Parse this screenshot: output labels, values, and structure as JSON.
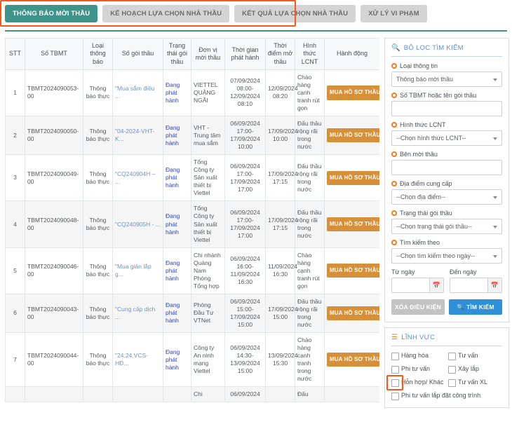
{
  "tabs": [
    {
      "label": "THÔNG BÁO MỜI THẦU",
      "active": true
    },
    {
      "label": "KẾ HOẠCH LỰA CHỌN NHÀ THẦU",
      "active": false
    },
    {
      "label": "KẾT QUẢ LỰA CHỌN NHÀ THẦU",
      "active": false
    },
    {
      "label": "XỬ LÝ VI PHẠM",
      "active": false
    }
  ],
  "table": {
    "headers": [
      "STT",
      "Số TBMT",
      "Loại thông báo",
      "Số gói thầu",
      "Trạng thái gói thầu",
      "Đơn vị mời thầu",
      "Thời gian phát hành",
      "Thời điểm mở thầu",
      "Hình thức LCNT",
      "Hành động"
    ],
    "action_label": "MUA HỒ SƠ THẦU",
    "rows": [
      {
        "stt": "1",
        "so_tbmt": "TBMT2024090053-00",
        "loai_thong_bao": "Thông báo thực",
        "so_goi_thau": "\"Mua sắm điều ...",
        "trang_thai": "Đang phát hành",
        "don_vi": "VIETTEL QUẢNG NGÃI",
        "thoi_gian_phat_hanh": "07/09/2024 08:00-12/09/2024 08:10",
        "thoi_diem_mo_thau": "12/09/2024 08:20",
        "hinh_thuc_lcnt": "Chào hàng cạnh tranh rút gọn"
      },
      {
        "stt": "2",
        "so_tbmt": "TBMT2024090050-00",
        "loai_thong_bao": "Thông báo thực",
        "so_goi_thau": "\"04-2024-VHT-K...",
        "trang_thai": "Đang phát hành",
        "don_vi": "VHT - Trung tâm mua sắm",
        "thoi_gian_phat_hanh": "06/09/2024 17:00-17/09/2024 10:00",
        "thoi_diem_mo_thau": "17/09/2024 10:00",
        "hinh_thuc_lcnt": "Đấu thầu rộng rãi trong nước"
      },
      {
        "stt": "3",
        "so_tbmt": "TBMT2024090049-00",
        "loai_thong_bao": "Thông báo thực",
        "so_goi_thau": "\"CQ240904H – ...",
        "trang_thai": "Đang phát hành",
        "don_vi": "Tổng Công ty Sản xuất thiết bị Viettel",
        "thoi_gian_phat_hanh": "06/09/2024 17:00-17/09/2024 17:00",
        "thoi_diem_mo_thau": "17/09/2024 17:15",
        "hinh_thuc_lcnt": "Đấu thầu rộng rãi trong nước"
      },
      {
        "stt": "4",
        "so_tbmt": "TBMT2024090048-00",
        "loai_thong_bao": "Thông báo thực",
        "so_goi_thau": "\"CQ240905H - ...",
        "trang_thai": "Đang phát hành",
        "don_vi": "Tổng Công ty Sản xuất thiết bị Viettel",
        "thoi_gian_phat_hanh": "06/09/2024 17:00-17/09/2024 17:00",
        "thoi_diem_mo_thau": "17/09/2024 17:15",
        "hinh_thuc_lcnt": "Đấu thầu rộng rãi trong nước"
      },
      {
        "stt": "5",
        "so_tbmt": "TBMT2024090046-00",
        "loai_thong_bao": "Thông báo thực",
        "so_goi_thau": "\"Mua giản lắp g...",
        "trang_thai": "Đang phát hành",
        "don_vi": "Chi nhánh Quảng Nam Phòng Tổng hợp",
        "thoi_gian_phat_hanh": "06/09/2024 16:00-11/09/2024 16:30",
        "thoi_diem_mo_thau": "11/09/2024 16:30",
        "hinh_thuc_lcnt": "Chào hàng cạnh tranh rút gọn"
      },
      {
        "stt": "6",
        "so_tbmt": "TBMT2024090043-00",
        "loai_thong_bao": "Thông báo thực",
        "so_goi_thau": "\"Cung cấp dịch ...",
        "trang_thai": "Đang phát hành",
        "don_vi": "Phòng Đầu Tư VTNet",
        "thoi_gian_phat_hanh": "06/09/2024 15:00-17/09/2024 15:00",
        "thoi_diem_mo_thau": "17/09/2024 15:00",
        "hinh_thuc_lcnt": "Đấu thầu rộng rãi trong nước"
      },
      {
        "stt": "7",
        "so_tbmt": "TBMT2024090044-00",
        "loai_thong_bao": "Thông báo thực",
        "so_goi_thau": "\"24.24.VCS-HĐ...",
        "trang_thai": "Đang phát hành",
        "don_vi": "Công ty An ninh mạng Viettel",
        "thoi_gian_phat_hanh": "06/09/2024 14:30-13/09/2024 15:00",
        "thoi_diem_mo_thau": "13/09/2024 15:30",
        "hinh_thuc_lcnt": "Chào hàng cạnh tranh trong nước"
      },
      {
        "stt": "",
        "so_tbmt": "",
        "loai_thong_bao": "",
        "so_goi_thau": "",
        "trang_thai": "",
        "don_vi": "Chi",
        "thoi_gian_phat_hanh": "06/09/2024",
        "thoi_diem_mo_thau": "",
        "hinh_thuc_lcnt": "Đấu",
        "partial": true
      }
    ]
  },
  "filter_panel": {
    "title": "BỘ LỌC TÌM KIẾM",
    "icon": "search-icon",
    "fields": [
      {
        "label": "Loại thông tin",
        "value": "Thông báo mời thầu",
        "type": "select"
      },
      {
        "label": "Số TBMT hoặc tên gói thầu",
        "value": "",
        "type": "text"
      },
      {
        "label": "Hình thức LCNT",
        "value": "--Chọn hình thức LCNT--",
        "type": "select"
      },
      {
        "label": "Bên mời thầu",
        "value": "",
        "type": "text"
      },
      {
        "label": "Địa điểm cung cấp",
        "value": "--Chọn địa điểm--",
        "type": "select"
      },
      {
        "label": "Trạng thái gói thầu",
        "value": "--Chọn trạng thái gói thầu--",
        "type": "select"
      },
      {
        "label": "Tìm kiếm theo",
        "value": "--Chọn tìm kiếm theo ngày--",
        "type": "select"
      }
    ],
    "date_from": {
      "label": "Từ ngày",
      "value": ""
    },
    "date_to": {
      "label": "Đến ngày",
      "value": ""
    },
    "calendar_icon": "calendar-icon",
    "buttons": {
      "clear": "XÓA ĐIỀU KIỆN",
      "search": "TÌM KIẾM"
    }
  },
  "sector_panel": {
    "title": "LĨNH VỰC",
    "icon": "list-icon",
    "items": [
      {
        "label": "Hàng hóa",
        "checked": false,
        "highlighted": true
      },
      {
        "label": "Tư vấn",
        "checked": false
      },
      {
        "label": "Phi tư vấn",
        "checked": false
      },
      {
        "label": "Xây lắp",
        "checked": false
      },
      {
        "label": "Hỗn hợp/ Khác",
        "checked": false
      },
      {
        "label": "Tư vấn XL",
        "checked": false
      },
      {
        "label": "Phi tư vấn lắp đặt công trình",
        "checked": false,
        "wide": true
      }
    ]
  },
  "colors": {
    "accent_teal": "#3f9489",
    "accent_orange": "#ee7d22",
    "highlight": "#f4581a",
    "button_buy": "#d6903a",
    "button_search": "#2f8fd8",
    "link": "#6f93c4",
    "state_link": "#2b44c7"
  }
}
